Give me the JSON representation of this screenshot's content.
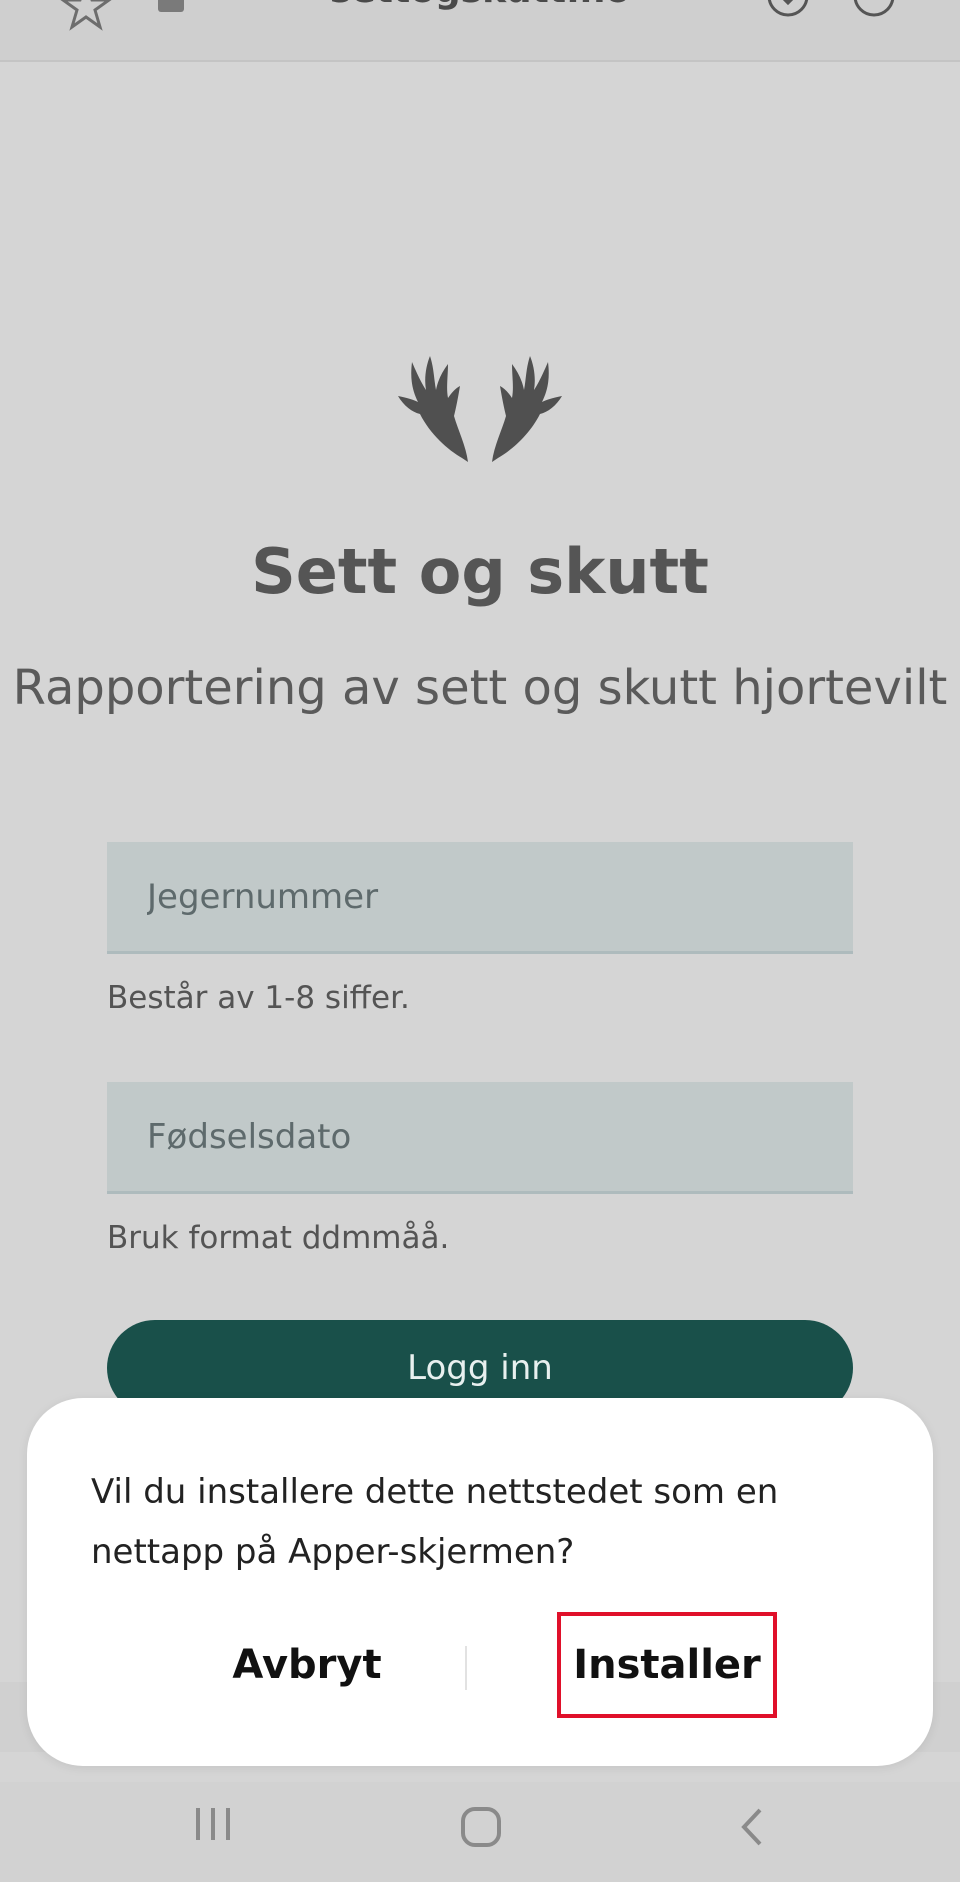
{
  "browser": {
    "url": "settogskutt.no"
  },
  "page": {
    "title": "Sett og skutt",
    "subtitle": "Rapportering av sett og skutt hjortevilt",
    "fields": [
      {
        "placeholder": "Jegernummer",
        "hint": "Består av 1-8 siffer."
      },
      {
        "placeholder": "Fødselsdato",
        "hint": "Bruk format ddmmåå."
      }
    ],
    "login_label": "Logg inn"
  },
  "dialog": {
    "message": "Vil du installere dette nettstedet som en nettapp på Apper-skjermen?",
    "cancel_label": "Avbryt",
    "install_label": "Installer",
    "highlight_color": "#e0102a"
  },
  "colors": {
    "background": "#d5d5d5",
    "field_bg": "#c1c9c9",
    "primary": "#19504a"
  }
}
